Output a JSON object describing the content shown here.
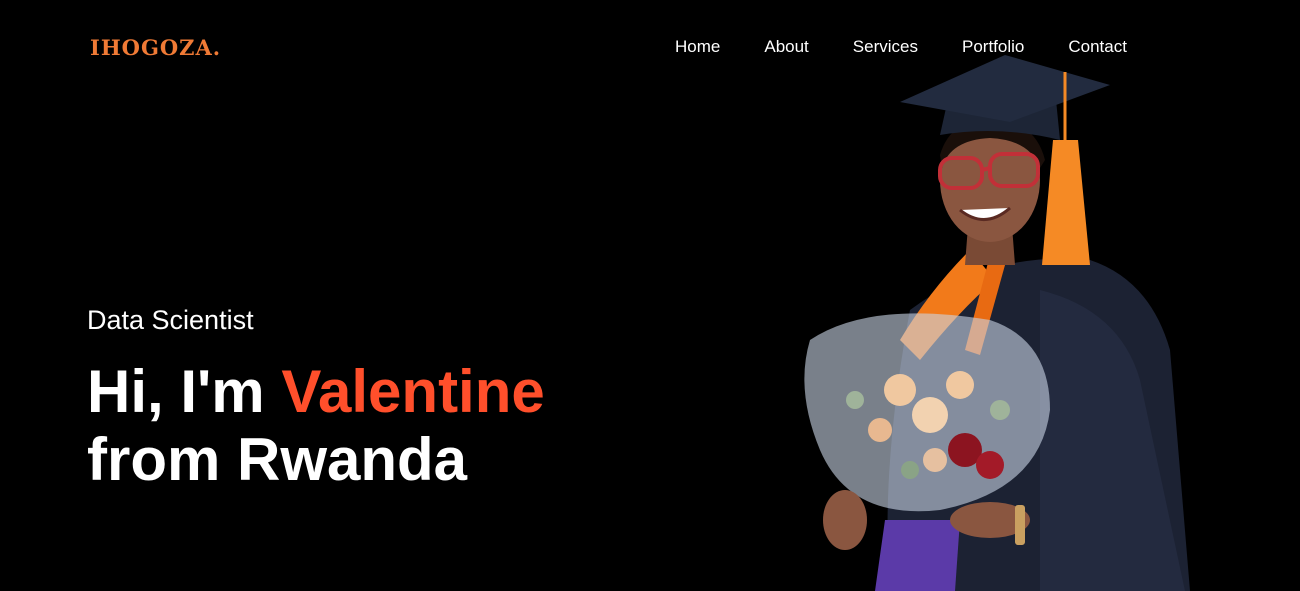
{
  "brand": {
    "name": "IHOGOZA.",
    "color": "#f07a35"
  },
  "nav": {
    "items": [
      {
        "label": "Home"
      },
      {
        "label": "About"
      },
      {
        "label": "Services"
      },
      {
        "label": "Portfolio"
      },
      {
        "label": "Contact"
      }
    ]
  },
  "hero": {
    "subtitle": "Data Scientist",
    "greeting": "Hi, I'm",
    "name": "Valentine",
    "line2": "from Rwanda",
    "accent_color": "#ff4f2b"
  },
  "photo": {
    "subject": "graduate-portrait-icon"
  }
}
